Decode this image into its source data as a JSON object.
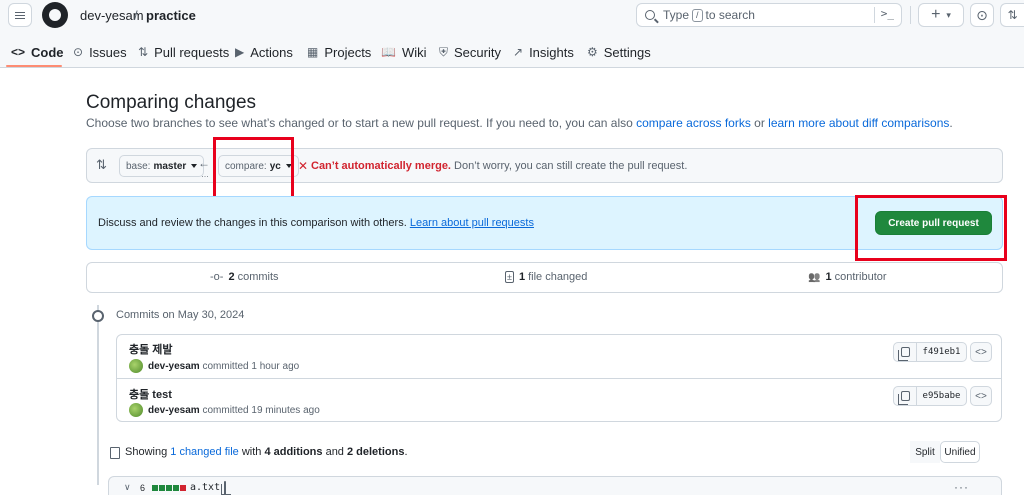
{
  "header": {
    "owner": "dev-yesam",
    "separator": "/",
    "repo": "practice",
    "search": {
      "type_text": "Type",
      "slash_key": "/",
      "rest_text": "to search",
      "command_glyph": ">_"
    },
    "plus_label": "+",
    "plus_caret": "▾",
    "issues_glyph": "⊙",
    "pulls_glyph": "⇅"
  },
  "nav": {
    "tabs": [
      {
        "label": "Code",
        "icon": "<>"
      },
      {
        "label": "Issues",
        "icon": "⊙"
      },
      {
        "label": "Pull requests",
        "icon": "⇅"
      },
      {
        "label": "Actions",
        "icon": "▶"
      },
      {
        "label": "Projects",
        "icon": "▦"
      },
      {
        "label": "Wiki",
        "icon": "📖"
      },
      {
        "label": "Security",
        "icon": "⛨"
      },
      {
        "label": "Insights",
        "icon": "↗"
      },
      {
        "label": "Settings",
        "icon": "⚙"
      }
    ]
  },
  "page": {
    "title": "Comparing changes",
    "subtitle_prefix": "Choose two branches to see what’s changed or to start a new pull request. If you need to, you can also ",
    "subtitle_link1": "compare across forks",
    "subtitle_mid": " or ",
    "subtitle_link2": "learn more about diff comparisons",
    "subtitle_suffix": "."
  },
  "compare": {
    "swap_glyph": "⇅",
    "base_prefix": "base:",
    "base_branch": "master",
    "arrow_glyph": "←",
    "arrow_dots": "…",
    "compare_prefix": "compare:",
    "compare_branch": "yc",
    "merge_x": "✕",
    "merge_title": "Can’t automatically merge.",
    "merge_detail": " Don’t worry, you can still create the pull request."
  },
  "banner": {
    "text": "Discuss and review the changes in this comparison with others. ",
    "link": "Learn about pull requests",
    "button": "Create pull request"
  },
  "stats": {
    "commits_glyph": "-o-",
    "commits_count": "2",
    "commits_label": "commits",
    "files_glyph": "±",
    "files_count": "1",
    "files_label": "file changed",
    "contributors_glyph": "👥",
    "contributors_count": "1",
    "contributors_label": "contributor"
  },
  "commits": {
    "date_label": "Commits on May 30, 2024",
    "items": [
      {
        "title": "충돌 제발",
        "author": "dev-yesam",
        "meta": " committed 1 hour ago",
        "sha": "f491eb1"
      },
      {
        "title": "충돌 test",
        "author": "dev-yesam",
        "meta": " committed 19 minutes ago",
        "sha": "e95babe"
      }
    ],
    "browse_glyph": "<>"
  },
  "changes": {
    "prefix": "Showing ",
    "link": "1 changed file",
    "mid1": " with ",
    "additions": "4 additions",
    "mid2": " and ",
    "deletions": "2 deletions",
    "suffix": ".",
    "split_label": "Split",
    "unified_label": "Unified"
  },
  "file": {
    "chevron": "∨",
    "count": "6",
    "diffstat": [
      "#1f883d",
      "#1f883d",
      "#1f883d",
      "#1f883d",
      "#d1242f"
    ],
    "name": "a.txt",
    "more_glyph": "···"
  }
}
